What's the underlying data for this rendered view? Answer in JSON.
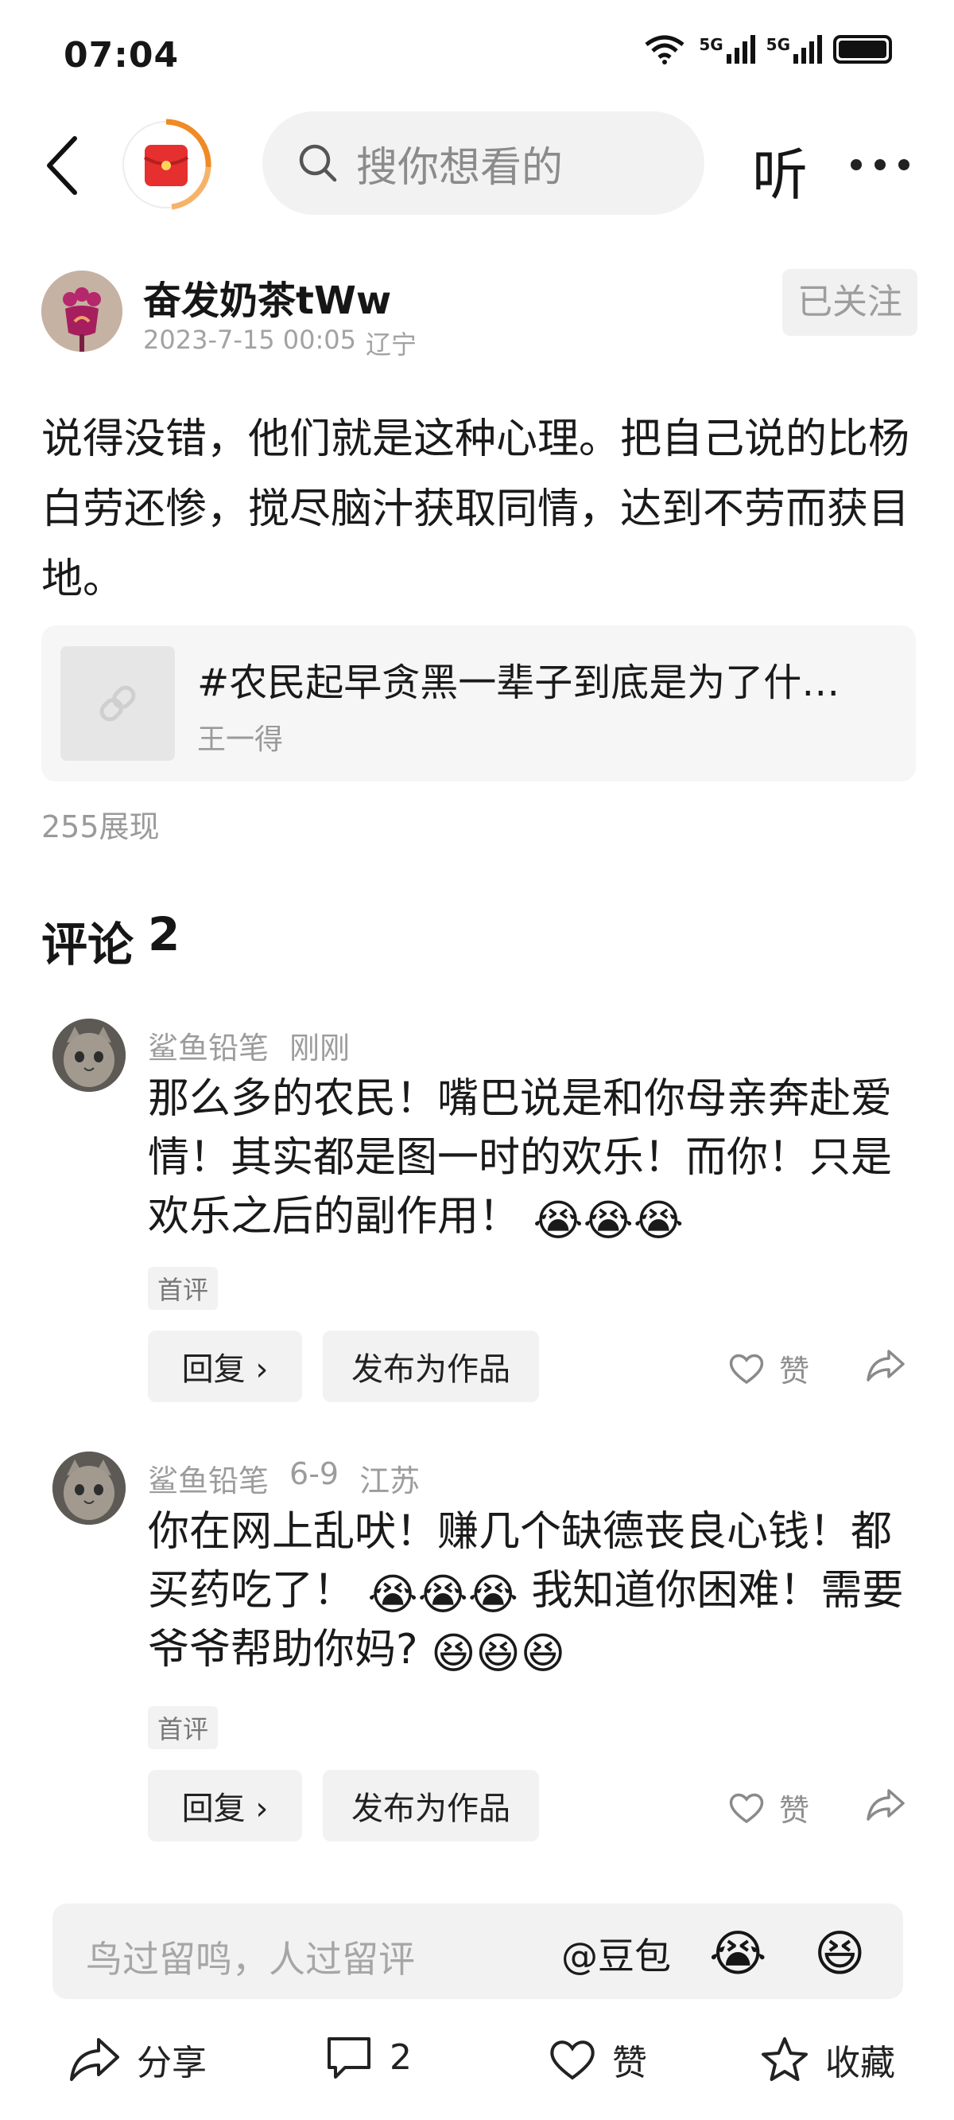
{
  "status_bar": {
    "time": "07:04",
    "net1": "5G",
    "net2": "5G"
  },
  "search": {
    "placeholder": "搜你想看的"
  },
  "header": {
    "listen_label": "听"
  },
  "author": {
    "name": "奋发奶茶tWw",
    "date": "2023-7-15 00:05",
    "location": "辽宁",
    "follow_label": "已关注"
  },
  "post": {
    "text": "说得没错，他们就是这种心理。把自己说的比杨白劳还惨，搅尽脑汁获取同情，达到不劳而获目地。",
    "link_title": "#农民起早贪黑一辈子到底是为了什…",
    "link_author": "王一得",
    "views": "255展现"
  },
  "comments_section": {
    "title": "评论",
    "count": "2"
  },
  "comments": [
    {
      "user": "鲨鱼铅笔",
      "time": "刚刚",
      "location": "",
      "text": "那么多的农民！嘴巴说是和你母亲奔赴爱情！其实都是图一时的欢乐！而你！只是欢乐之后的副作用！",
      "emojis": "😭😭😭",
      "tag": "首评",
      "reply_label": "回复 ›",
      "publish_label": "发布为作品",
      "like_label": "赞"
    },
    {
      "user": "鲨鱼铅笔",
      "time": "6-9",
      "location": "江苏",
      "text_a": "你在网上乱吠！赚几个缺德丧良心钱！都买药吃了！",
      "emojis_a": "😭😭😭",
      "text_b": "我知道你困难！需要爷爷帮助你妈?",
      "emojis_b": "😆😆😆",
      "tag": "首评",
      "reply_label": "回复 ›",
      "publish_label": "发布为作品",
      "like_label": "赞"
    }
  ],
  "input": {
    "placeholder": "鸟过留鸣，人过留评",
    "mention": "@豆包",
    "emoji1": "😭",
    "emoji2": "😆"
  },
  "bottom_bar": {
    "share_label": "分享",
    "comment_count": "2",
    "like_label": "赞",
    "favorite_label": "收藏"
  }
}
